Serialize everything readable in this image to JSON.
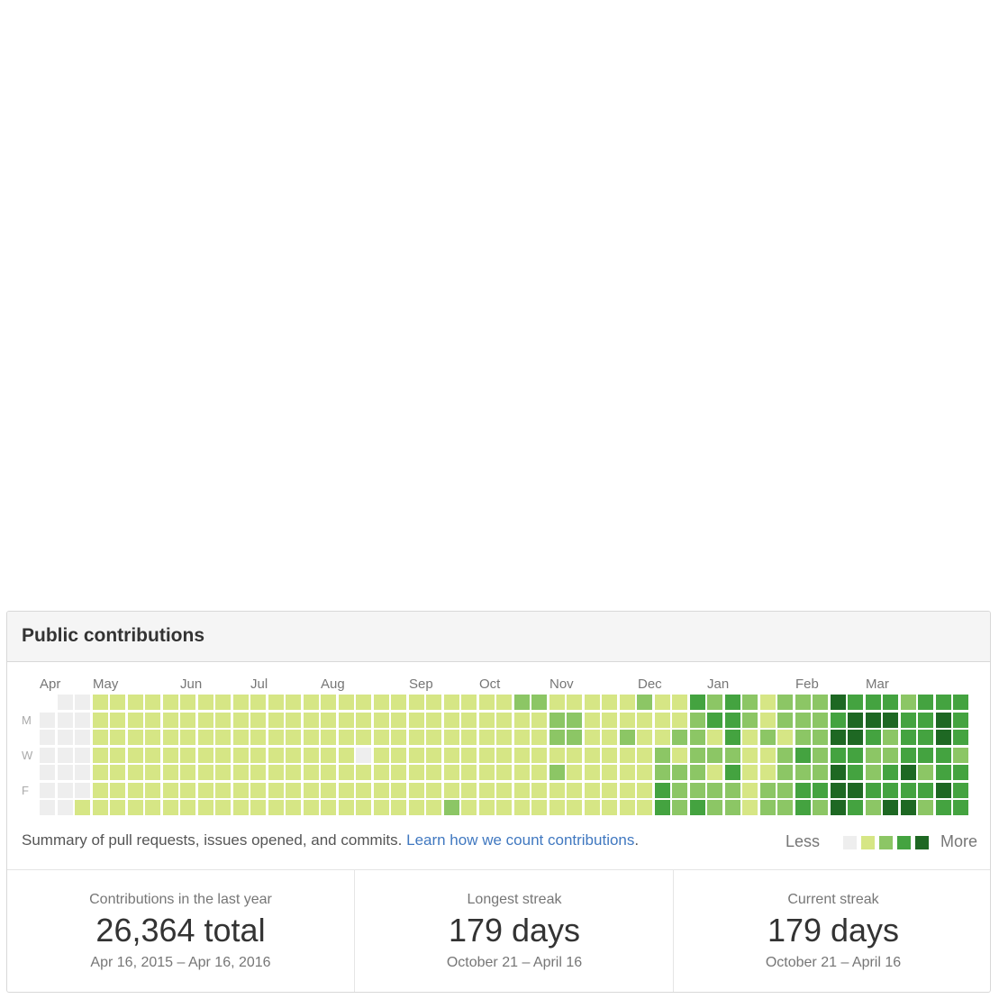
{
  "panel": {
    "title": "Public contributions"
  },
  "months": [
    "Apr",
    "May",
    "Jun",
    "Jul",
    "Aug",
    "Sep",
    "Oct",
    "Nov",
    "Dec",
    "Jan",
    "Feb",
    "Mar"
  ],
  "days": [
    "M",
    "W",
    "F"
  ],
  "summary": {
    "text": "Summary of pull requests, issues opened, and commits.",
    "link": "Learn how we count contributions",
    "period": "."
  },
  "legend": {
    "less": "Less",
    "more": "More"
  },
  "colors": [
    "#eeeeee",
    "#d6e685",
    "#8cc665",
    "#44a340",
    "#1e6823"
  ],
  "grid_levels": [
    "1111111100000000000000000",
    "1111111000000000000000000",
    "1111111111111111111111111",
    "1111111111111111111111111",
    "1111111111111111111111111",
    "1111111111111111111111111",
    "1111111111111111111111111",
    "1111111111111111111111111",
    "1111111111111111111111111",
    "1111111111111111111111111",
    "1111111111111111111111111",
    "1111111111111111111111111",
    "1111111111111111111111111",
    "1111111111111111111111111",
    "1111111111111111111111111",
    "1111111111111111111111111",
    "1111111111111111111111111",
    "1111111111111111111111111",
    "1111111111111111111111111",
    "1111111111111111111111111",
    "1111111111111111111111111",
    "1111111111111111111111111",
    "1111111111111111111111111",
    "1111111111111111111111111",
    "1111111111111111111111111",
    "1111111111111111111111111",
    "1111111111111111111111111",
    "1111111111111111111111111",
    "1111111111111111111111111",
    "1111111111111111111111111",
    "1111111111111111111111111",
    "1111111111111111111111111",
    "1111111111111111111111111",
    "1111111111111111111111111",
    "1111111111111111111111111",
    "1111111111111111111111111",
    "1111111111111111111111111",
    "1111111111111111111111111",
    "1111111111111111111111111",
    "1111111111111111111111111",
    "1111111111111111111111111",
    "1111111111111111111111111",
    "1111111111111111111111111",
    "1111111111111111111111111",
    "1111111111111111111111111",
    "1111111111111111111111111",
    "1111111111111111111111111",
    "1111111111111111111111111",
    "1111111111111111111111111",
    "1111111111111111111111111",
    "1111111111111111111111111",
    "1111111111111111111111111",
    "1111111111111111111111111"
  ],
  "weeks": [
    "0000000",
    "0000000",
    "0000000",
    "0000000",
    "0000000",
    "0000000",
    "0000000",
    "0000001",
    "1111111",
    "1111111",
    "1111111",
    "1111111",
    "1111111",
    "1111111",
    "1111111",
    "1111111",
    "1111111",
    "1111111",
    "1111111",
    "1111111",
    "1111111",
    "1111111",
    "1111111",
    "1110111",
    "1111111",
    "1111111",
    "1111111",
    "1111111",
    "1111112",
    "1111111",
    "1111111",
    "1111111",
    "2111111",
    "2111111",
    "1221211",
    "1221111",
    "1111111",
    "1111111",
    "1121111",
    "2111111",
    "1112233",
    "1121222",
    "3222223",
    "2312122",
    "3332322",
    "2211111",
    "1121122",
    "2212222",
    "2223233",
    "2222232",
    "4343444",
    "3443343",
    "3432232",
    "3422334",
    "2333434",
    "3333232",
    "3443343",
    "3332333"
  ],
  "stats": [
    {
      "label": "Contributions in the last year",
      "value": "26,364 total",
      "range": "Apr 16, 2015 – Apr 16, 2016"
    },
    {
      "label": "Longest streak",
      "value": "179 days",
      "range": "October 21 – April 16"
    },
    {
      "label": "Current streak",
      "value": "179 days",
      "range": "October 21 – April 16"
    }
  ]
}
